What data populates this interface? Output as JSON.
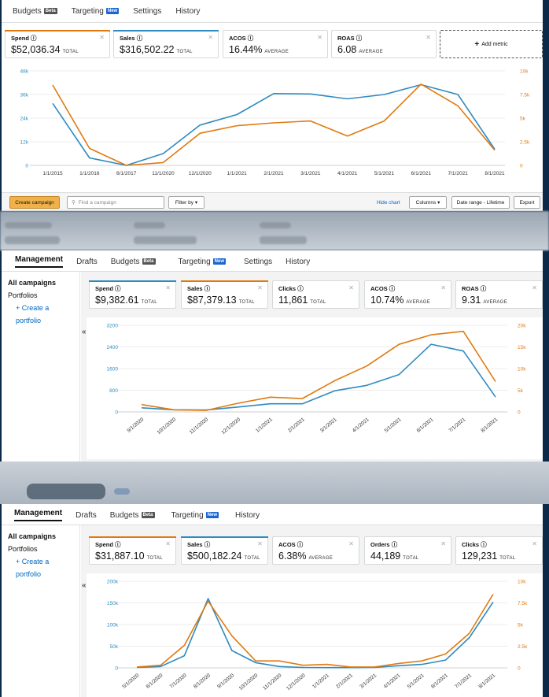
{
  "colors": {
    "spend": "#e07a10",
    "sales": "#2e8bc0",
    "grid": "#e6e6e6"
  },
  "p1": {
    "nav": [
      {
        "label": "Budgets",
        "badge": "Beta"
      },
      {
        "label": "Targeting",
        "badge": "New"
      },
      {
        "label": "Settings",
        "badge": ""
      },
      {
        "label": "History",
        "badge": ""
      }
    ],
    "metrics": [
      {
        "title": "Spend",
        "value": "$52,036.34",
        "suffix": "TOTAL",
        "bar": "orange"
      },
      {
        "title": "Sales",
        "value": "$316,502.22",
        "suffix": "TOTAL",
        "bar": "blue"
      },
      {
        "title": "ACOS",
        "value": "16.44%",
        "suffix": "AVERAGE",
        "bar": ""
      },
      {
        "title": "ROAS",
        "value": "6.08",
        "suffix": "AVERAGE",
        "bar": ""
      }
    ],
    "add_metric": "Add metric",
    "toolbar": {
      "create": "Create campaign",
      "search_placeholder": "Find a campaign",
      "filter": "Filter by",
      "hide_chart": "Hide chart",
      "columns": "Columns",
      "date_range": "Date range - Lifetime",
      "export": "Export"
    }
  },
  "p2": {
    "nav": [
      {
        "label": "Management",
        "badge": ""
      },
      {
        "label": "Drafts",
        "badge": ""
      },
      {
        "label": "Budgets",
        "badge": "Beta"
      },
      {
        "label": "Targeting",
        "badge": "New"
      },
      {
        "label": "Settings",
        "badge": ""
      },
      {
        "label": "History",
        "badge": ""
      }
    ],
    "side": [
      "All campaigns",
      "Portfolios",
      "+ Create a portfolio"
    ],
    "metrics": [
      {
        "title": "Spend",
        "value": "$9,382.61",
        "suffix": "TOTAL",
        "bar": "blue"
      },
      {
        "title": "Sales",
        "value": "$87,379.13",
        "suffix": "TOTAL",
        "bar": "orange"
      },
      {
        "title": "Clicks",
        "value": "11,861",
        "suffix": "TOTAL",
        "bar": ""
      },
      {
        "title": "ACOS",
        "value": "10.74%",
        "suffix": "AVERAGE",
        "bar": ""
      },
      {
        "title": "ROAS",
        "value": "9.31",
        "suffix": "AVERAGE",
        "bar": ""
      }
    ]
  },
  "p3": {
    "nav": [
      {
        "label": "Management",
        "badge": ""
      },
      {
        "label": "Drafts",
        "badge": ""
      },
      {
        "label": "Budgets",
        "badge": "Beta"
      },
      {
        "label": "Targeting",
        "badge": "New"
      },
      {
        "label": "History",
        "badge": ""
      }
    ],
    "side": [
      "All campaigns",
      "Portfolios",
      "+ Create a portfolio"
    ],
    "metrics": [
      {
        "title": "Spend",
        "value": "$31,887.10",
        "suffix": "TOTAL",
        "bar": "orange"
      },
      {
        "title": "Sales",
        "value": "$500,182.24",
        "suffix": "TOTAL",
        "bar": "blue"
      },
      {
        "title": "ACOS",
        "value": "6.38%",
        "suffix": "AVERAGE",
        "bar": ""
      },
      {
        "title": "Orders",
        "value": "44,189",
        "suffix": "TOTAL",
        "bar": ""
      },
      {
        "title": "Clicks",
        "value": "129,231",
        "suffix": "TOTAL",
        "bar": ""
      }
    ]
  },
  "chart_data": [
    {
      "type": "line",
      "categories": [
        "1/1/2015",
        "1/1/2016",
        "6/1/2017",
        "11/1/2020",
        "12/1/2020",
        "1/1/2021",
        "2/1/2021",
        "3/1/2021",
        "4/1/2021",
        "5/1/2021",
        "6/1/2021",
        "7/1/2021",
        "8/1/2021"
      ],
      "left_ticks": [
        "0",
        "12k",
        "24k",
        "36k",
        "48k"
      ],
      "right_ticks": [
        "0",
        "2.5k",
        "5k",
        "7.5k",
        "10k"
      ],
      "ylim_left": [
        0,
        48000
      ],
      "ylim_right": [
        0,
        10000
      ],
      "series": [
        {
          "axis": "left",
          "color": "blue",
          "values": [
            31500,
            3800,
            0,
            6000,
            20500,
            25800,
            36500,
            36300,
            33800,
            36000,
            41000,
            36000,
            8200
          ]
        },
        {
          "axis": "right",
          "color": "orange",
          "values": [
            8500,
            1800,
            0,
            300,
            3400,
            4200,
            4500,
            4700,
            3100,
            4700,
            8600,
            6300,
            1600
          ]
        }
      ]
    },
    {
      "type": "line",
      "categories": [
        "9/1/2020",
        "10/1/2020",
        "11/1/2020",
        "12/1/2020",
        "1/1/2021",
        "2/1/2021",
        "3/1/2021",
        "4/1/2021",
        "5/1/2021",
        "6/1/2021",
        "7/1/2021",
        "8/1/2021"
      ],
      "left_ticks": [
        "0",
        "800",
        "1600",
        "2400",
        "3200"
      ],
      "right_ticks": [
        "0",
        "5k",
        "10k",
        "15k",
        "20k"
      ],
      "ylim_left": [
        0,
        3200
      ],
      "ylim_right": [
        0,
        20000
      ],
      "series": [
        {
          "axis": "left",
          "color": "blue",
          "values": [
            150,
            80,
            70,
            180,
            300,
            300,
            780,
            980,
            1380,
            2500,
            2250,
            550
          ]
        },
        {
          "axis": "right",
          "color": "orange",
          "values": [
            1700,
            500,
            350,
            2000,
            3400,
            3100,
            7200,
            10600,
            15600,
            17800,
            18600,
            7000
          ]
        }
      ]
    },
    {
      "type": "line",
      "categories": [
        "5/1/2020",
        "6/1/2020",
        "7/1/2020",
        "8/1/2020",
        "9/1/2020",
        "10/1/2020",
        "11/1/2020",
        "12/1/2020",
        "1/1/2021",
        "2/1/2021",
        "3/1/2021",
        "4/1/2021",
        "5/1/2021",
        "6/1/2021",
        "7/1/2021",
        "8/1/2021"
      ],
      "left_ticks": [
        "0",
        "50k",
        "100k",
        "150k",
        "200k"
      ],
      "right_ticks": [
        "0",
        "2.5k",
        "5k",
        "7.5k",
        "10k"
      ],
      "ylim_left": [
        0,
        200000
      ],
      "ylim_right": [
        0,
        10000
      ],
      "series": [
        {
          "axis": "left",
          "color": "blue",
          "values": [
            1000,
            3000,
            28000,
            160000,
            40000,
            12000,
            3000,
            1000,
            500,
            500,
            1000,
            5000,
            8000,
            18000,
            70000,
            152000
          ]
        },
        {
          "axis": "right",
          "color": "orange",
          "values": [
            100,
            300,
            2600,
            7700,
            3700,
            800,
            800,
            300,
            400,
            100,
            100,
            500,
            800,
            1600,
            4000,
            8500
          ]
        }
      ]
    }
  ]
}
